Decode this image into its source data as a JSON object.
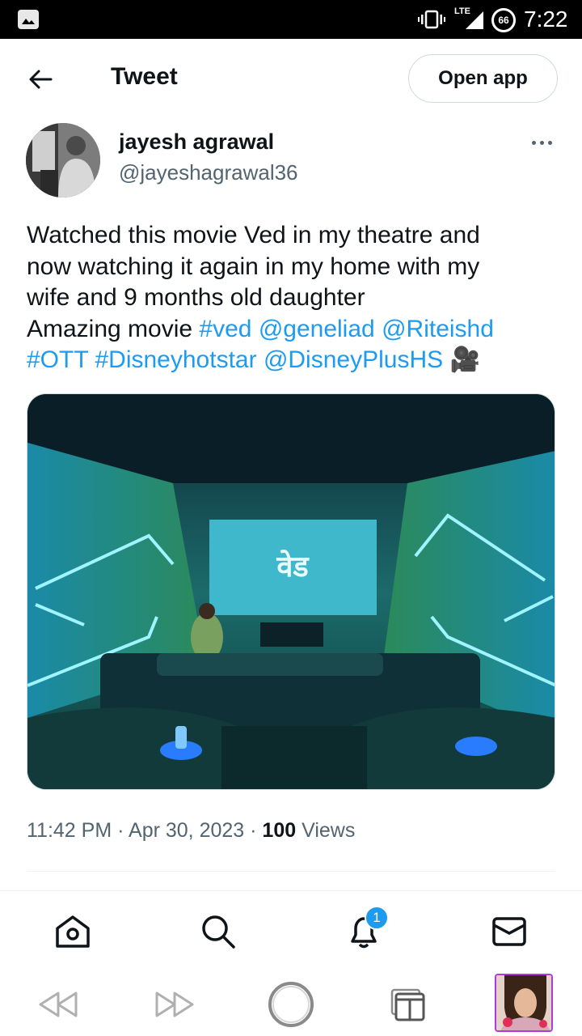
{
  "status_bar": {
    "network": "LTE",
    "battery": "66",
    "time": "7:22",
    "icons": [
      "gallery-icon",
      "vibrate-icon",
      "signal-icon",
      "battery-icon"
    ]
  },
  "header": {
    "back_icon": "arrow-left-icon",
    "title": "Tweet",
    "open_app_label": "Open app"
  },
  "author": {
    "name": "jayesh agrawal",
    "handle": "@jayeshagrawal36",
    "more_icon": "more-dots-icon"
  },
  "tweet": {
    "line1": "Watched this movie Ved in my theatre and",
    "line2": "now watching it again in my home with my",
    "line3": "wife and 9 months old daughter",
    "line4_text": "Amazing movie ",
    "links_line4": [
      "#ved",
      "@geneliad",
      "@Riteishd"
    ],
    "links_line5": [
      "#OTT",
      "#Disneyhotstar",
      "@DisneyPlusHS"
    ],
    "emoji": "🎥",
    "screen_text": "वेड"
  },
  "meta": {
    "time": "11:42 PM",
    "separator": "·",
    "date": "Apr 30, 2023",
    "views_count": "100",
    "views_label": "Views"
  },
  "tabbar": {
    "items": [
      "home-icon",
      "search-icon",
      "notifications-icon",
      "messages-icon"
    ],
    "notification_badge": "1"
  },
  "browser_nav": {
    "items": [
      "rewind-icon",
      "fast-forward-icon",
      "refresh-circle-icon",
      "tabs-icon",
      "profile-thumbnail"
    ]
  },
  "colors": {
    "link": "#1d9bf0",
    "text": "#0f1419",
    "muted": "#536471",
    "border": "#cfd9de"
  }
}
